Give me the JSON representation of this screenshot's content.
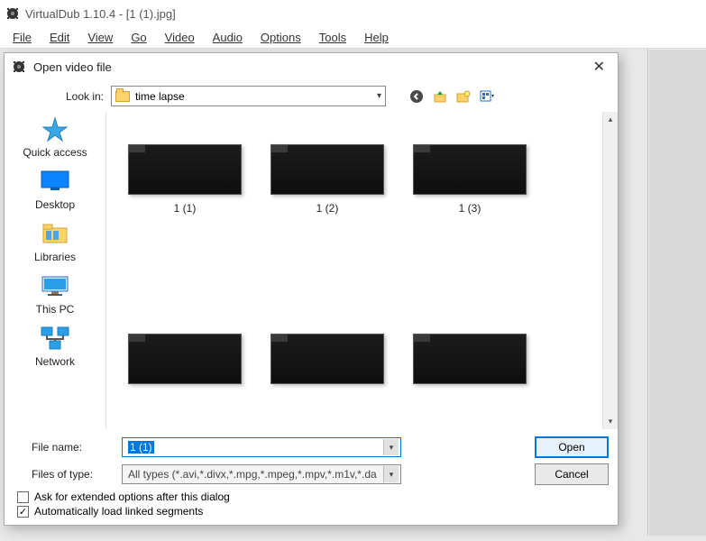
{
  "app": {
    "title": "VirtualDub 1.10.4 - [1 (1).jpg]",
    "menu": [
      "File",
      "Edit",
      "View",
      "Go",
      "Video",
      "Audio",
      "Options",
      "Tools",
      "Help"
    ]
  },
  "dialog": {
    "title": "Open video file",
    "look_in_label": "Look in:",
    "look_in_value": "time lapse",
    "places": [
      "Quick access",
      "Desktop",
      "Libraries",
      "This PC",
      "Network"
    ],
    "files": [
      "1 (1)",
      "1 (2)",
      "1 (3)",
      "",
      "",
      ""
    ],
    "file_name_label": "File name:",
    "file_name_value": "1 (1)",
    "file_type_label": "Files of type:",
    "file_type_value": "All types (*.avi,*.divx,*.mpg,*.mpeg,*.mpv,*.m1v,*.da",
    "open_btn": "Open",
    "cancel_btn": "Cancel",
    "check1": "Ask for extended options after this dialog",
    "check2": "Automatically load linked segments",
    "check1_checked": false,
    "check2_checked": true
  }
}
